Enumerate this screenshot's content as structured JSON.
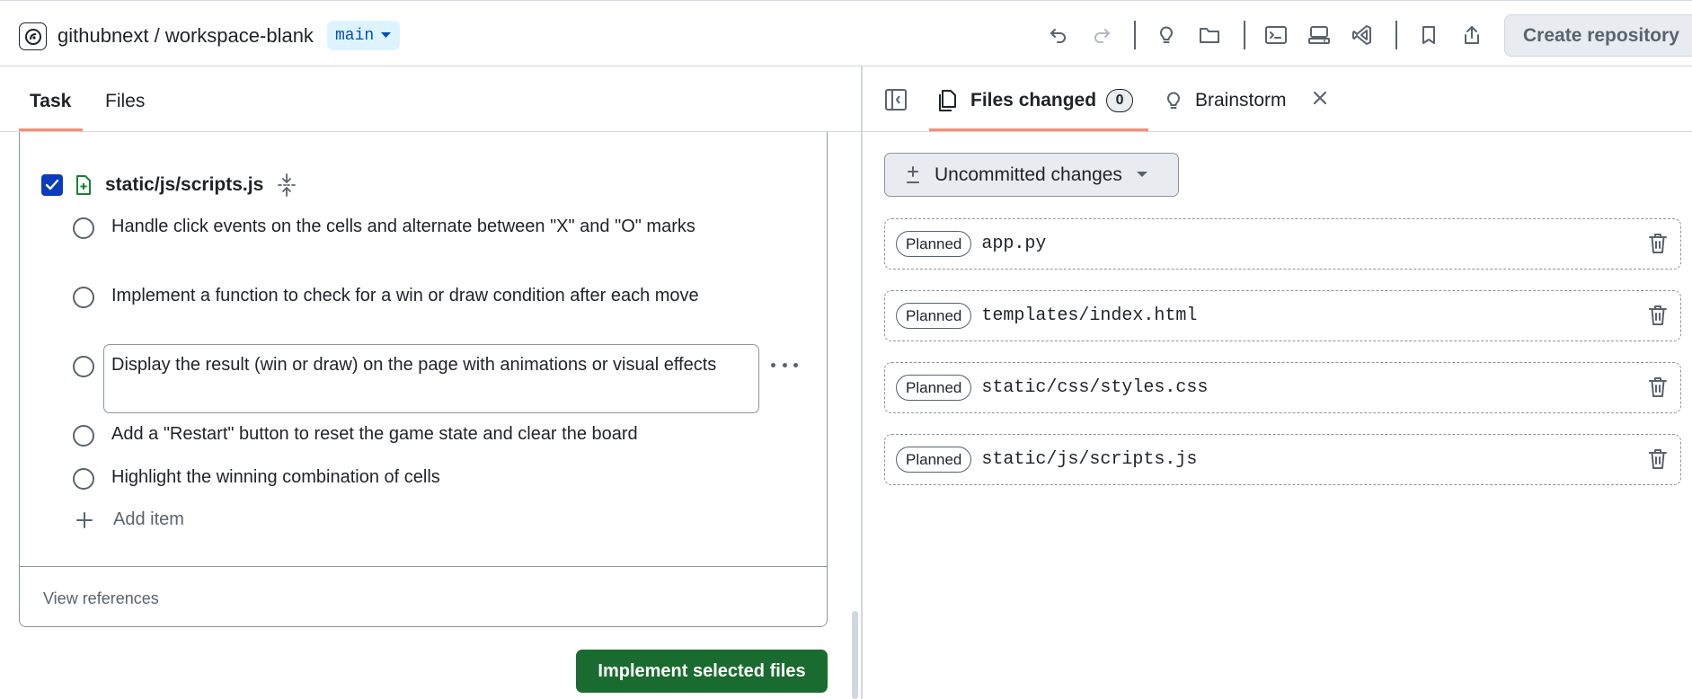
{
  "header": {
    "repo_title": "githubnext / workspace-blank",
    "branch": "main",
    "create_repo_label": "Create repository"
  },
  "left": {
    "tabs": [
      {
        "label": "Task",
        "active": true
      },
      {
        "label": "Files",
        "active": false
      }
    ],
    "file": {
      "name": "static/js/scripts.js",
      "checked": true
    },
    "tasks": [
      {
        "text": "Handle click events on the cells and alternate between \"X\" and \"O\" marks"
      },
      {
        "text": "Implement a function to check for a win or draw condition after each move"
      },
      {
        "text": "Display the result (win or draw) on the page with animations or visual effects"
      },
      {
        "text": "Add a \"Restart\" button to reset the game state and clear the board"
      },
      {
        "text": "Highlight the winning combination of cells"
      }
    ],
    "add_item_label": "Add item",
    "view_references_label": "View references",
    "implement_label": "Implement selected files"
  },
  "right": {
    "tabs": {
      "files_changed": {
        "label": "Files changed",
        "count": "0"
      },
      "brainstorm": {
        "label": "Brainstorm"
      }
    },
    "uncommitted_label": "Uncommitted changes",
    "changes": [
      {
        "status": "Planned",
        "path": "app.py"
      },
      {
        "status": "Planned",
        "path": "templates/index.html"
      },
      {
        "status": "Planned",
        "path": "static/css/styles.css"
      },
      {
        "status": "Planned",
        "path": "static/js/scripts.js"
      }
    ]
  },
  "colors": {
    "accent_underline": "#fd8c73",
    "primary_button": "#1a6b2f",
    "checkbox": "#0a3cbd",
    "branch_bg": "#ddf4ff"
  }
}
